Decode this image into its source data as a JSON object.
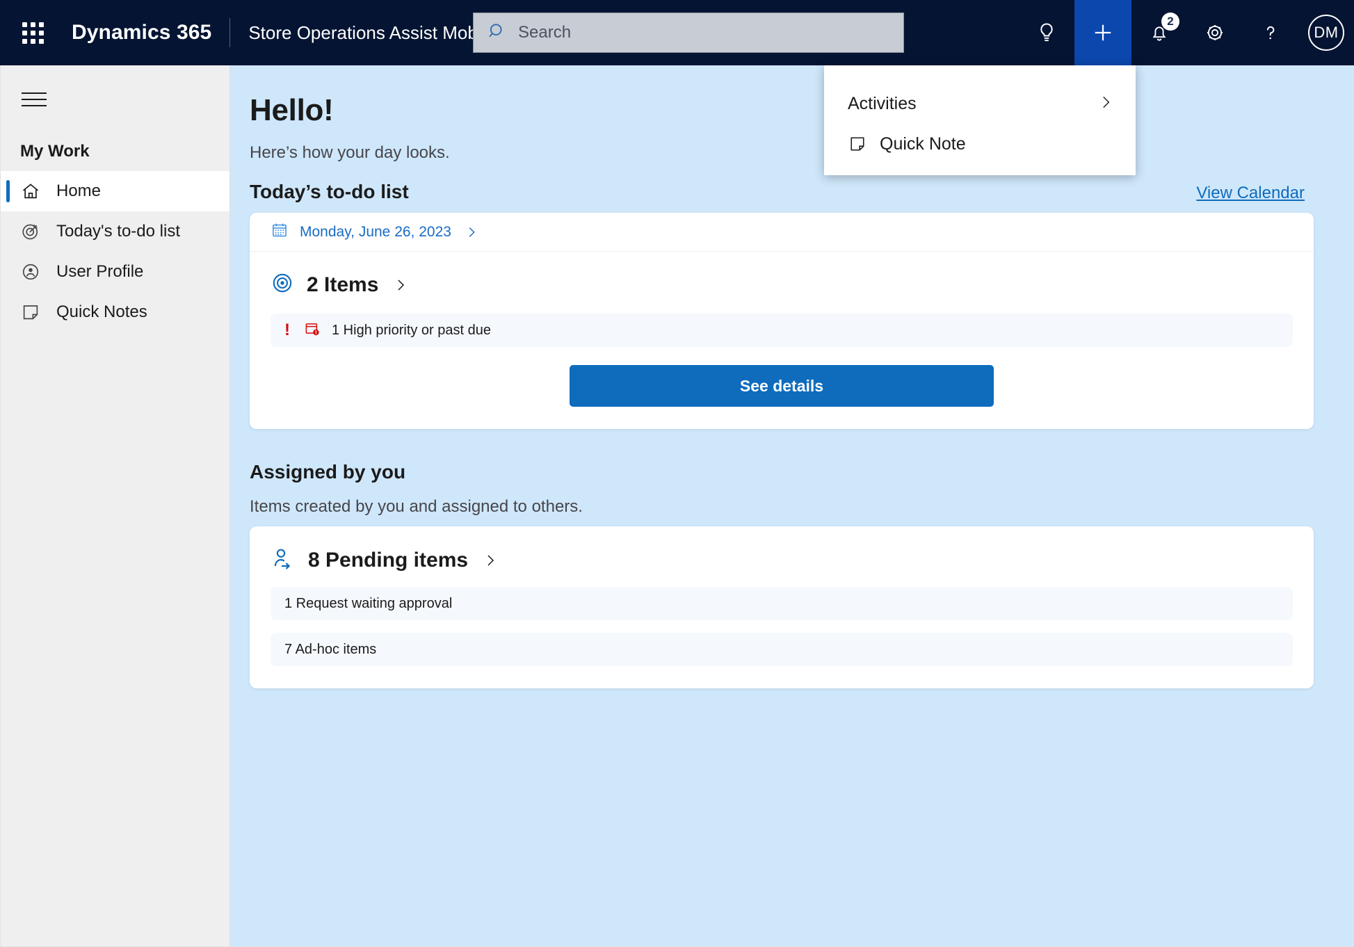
{
  "topbar": {
    "waffle_icon": "app-launcher-waffle-icon",
    "brand": "Dynamics 365",
    "app_name": "Store Operations Assist Mobile",
    "search": {
      "placeholder": "Search",
      "value": "",
      "icon": "search-icon"
    },
    "icons": {
      "lightbulb": "lightbulb-icon",
      "plus": "plus-icon",
      "notifications": "bell-icon",
      "notification_count": "2",
      "settings": "gear-icon",
      "help": "question-mark-icon"
    },
    "avatar_initials": "DM"
  },
  "dropdown": {
    "items": [
      {
        "label": "Activities",
        "icon": "chevron-right-icon",
        "has_submenu": true
      },
      {
        "label": "Quick Note",
        "icon": "note-icon",
        "has_submenu": false
      }
    ]
  },
  "sidebar": {
    "hamburger_icon": "hamburger-menu-icon",
    "group_title": "My Work",
    "items": [
      {
        "label": "Home",
        "icon": "home-icon",
        "active": true
      },
      {
        "label": "Today's to-do list",
        "icon": "target-icon",
        "active": false
      },
      {
        "label": "User Profile",
        "icon": "user-circle-icon",
        "active": false
      },
      {
        "label": "Quick Notes",
        "icon": "note-icon",
        "active": false
      }
    ]
  },
  "main": {
    "greeting": "Hello!",
    "greeting_sub": "Here’s how your day looks.",
    "todo": {
      "title": "Today’s to-do list",
      "view_calendar": "View Calendar",
      "date": "Monday, June 26, 2023",
      "date_icon": "calendar-icon",
      "count_label": "2 Items",
      "count_icon": "target-icon",
      "alert_icon": "calendar-alert-icon",
      "alert_exclamation": "!",
      "alert_text": "1 High priority or past due",
      "cta_label": "See details"
    },
    "assigned": {
      "title": "Assigned by you",
      "subtitle": "Items created by you and assigned to others.",
      "count_label": "8 Pending items",
      "count_icon": "assign-user-icon",
      "rows": [
        "1 Request waiting approval",
        "7 Ad-hoc items"
      ]
    }
  },
  "colors": {
    "topbar_bg": "#041432",
    "accent_blue": "#0f6cbd",
    "plus_active_bg": "#0b47ad",
    "main_bg": "#cfe7fb",
    "sidebar_bg": "#efefef",
    "alert_red": "#d60b0b"
  }
}
